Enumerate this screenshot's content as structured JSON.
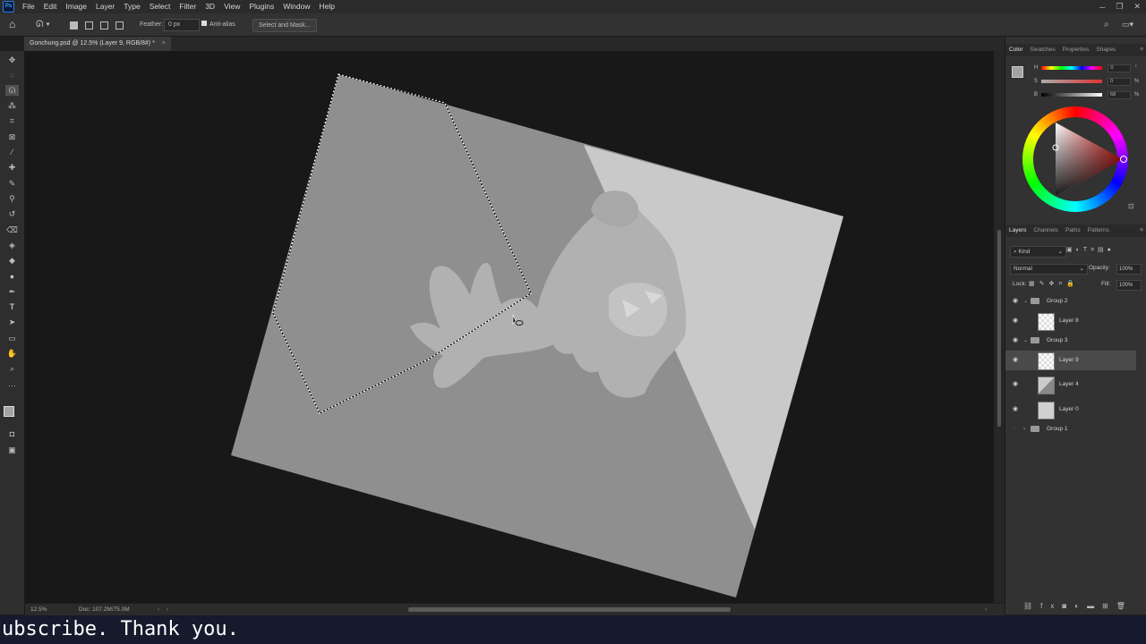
{
  "app": {
    "menu": [
      "File",
      "Edit",
      "Image",
      "Layer",
      "Type",
      "Select",
      "Filter",
      "3D",
      "View",
      "Plugins",
      "Window",
      "Help"
    ],
    "logo_text": "Ps"
  },
  "options": {
    "feather_label": "Feather:",
    "feather_value": "0 px",
    "antialias_label": "Anti-alias",
    "select_mask_label": "Select and Mask..."
  },
  "document": {
    "tab_title": "Gonchung.psd @ 12.5% (Layer 9, RGB/8#) *"
  },
  "status": {
    "zoom": "12.5%",
    "doc_info": "Doc: 107.2M/75.0M"
  },
  "color_panel": {
    "tabs": [
      "Color",
      "Swatches",
      "Properties",
      "Shapes"
    ],
    "h_label": "H",
    "h_value": "0",
    "s_label": "S",
    "s_value": "0",
    "b_label": "B",
    "b_value": "68",
    "percent": "%"
  },
  "layers_panel": {
    "tabs": [
      "Layers",
      "Channels",
      "Paths",
      "Patterns"
    ],
    "kind_label": "Kind",
    "blend_mode": "Normal",
    "opacity_label": "Opacity:",
    "opacity_value": "100%",
    "lock_label": "Lock:",
    "fill_label": "Fill:",
    "fill_value": "100%",
    "layers": [
      {
        "name": "Group 2",
        "type": "group"
      },
      {
        "name": "Layer 8",
        "type": "layer"
      },
      {
        "name": "Group 3",
        "type": "group"
      },
      {
        "name": "Layer 9",
        "type": "layer",
        "selected": true
      },
      {
        "name": "Layer 4",
        "type": "layer"
      },
      {
        "name": "Layer 0",
        "type": "layer"
      },
      {
        "name": "Group 1",
        "type": "group"
      }
    ]
  },
  "subtitle": "ubscribe. Thank you.",
  "colors": {
    "accent": "#31a8ff",
    "selected_layer": "#4a4a4a",
    "canvas_dark": "#8c8c8c",
    "canvas_light": "#c8c8c8"
  }
}
